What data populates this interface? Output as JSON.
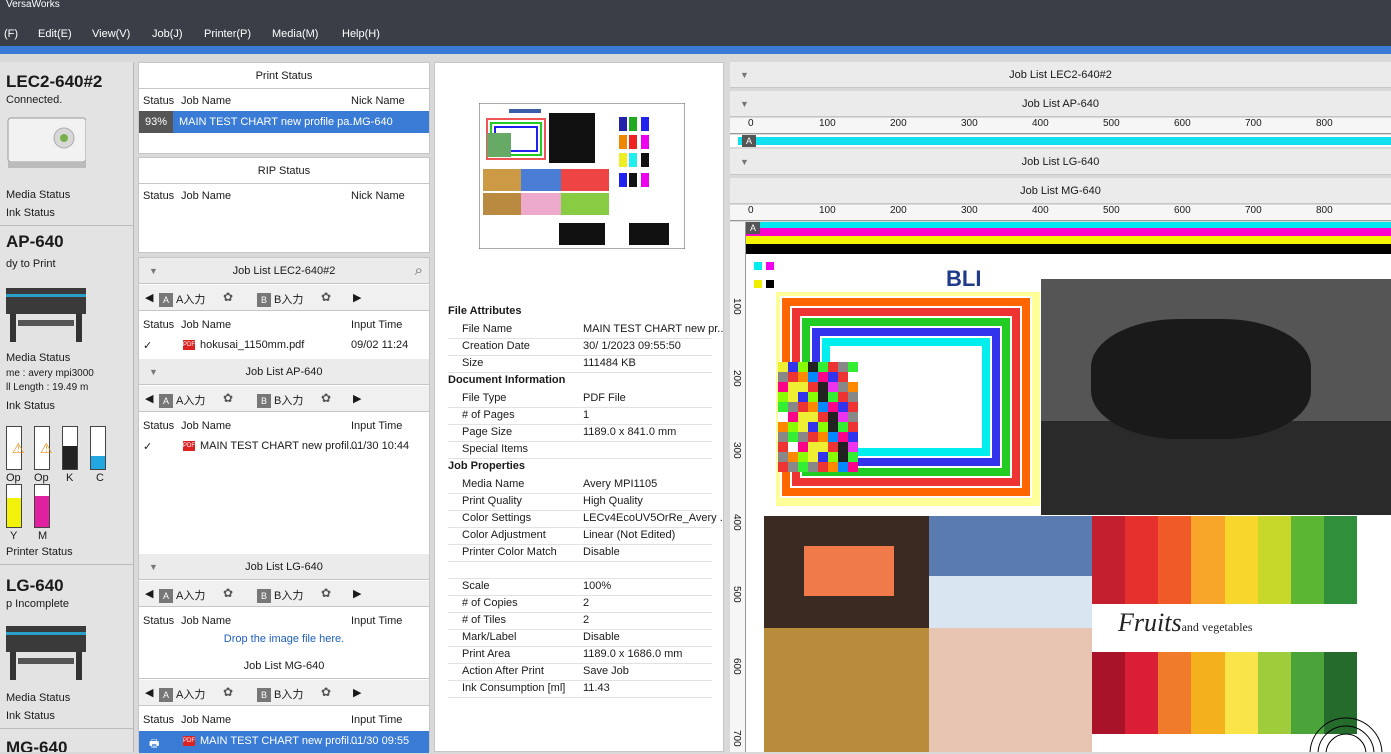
{
  "app": {
    "title": "VersaWorks"
  },
  "menu": [
    "(F)",
    "Edit(E)",
    "View(V)",
    "Job(J)",
    "Printer(P)",
    "Media(M)",
    "Help(H)"
  ],
  "printers": [
    {
      "name": "LEC2-640#2",
      "status": "Connected.",
      "media_status": "Media Status",
      "ink_status": "Ink Status"
    },
    {
      "name": "AP-640",
      "status": "dy to Print",
      "media_status": "Media Status",
      "media_name": "me : avery mpi3000",
      "roll_length": "ll Length : 19.49 m",
      "ink_status": "Ink Status",
      "printer_status": "Printer Status"
    },
    {
      "name": "LG-640",
      "status": "p Incomplete",
      "media_status": "Media Status",
      "ink_status": "Ink Status"
    },
    {
      "name": "MG-640"
    }
  ],
  "inks": [
    {
      "label": "Op",
      "color": "#ffffff",
      "warn": true,
      "level": 0.9
    },
    {
      "label": "Op",
      "color": "#ffffff",
      "warn": true,
      "level": 0.9
    },
    {
      "label": "K",
      "color": "#222222",
      "warn": false,
      "level": 0.55
    },
    {
      "label": "C",
      "color": "#22a7e0",
      "warn": false,
      "level": 0.3
    },
    {
      "label": "Y",
      "color": "#f2f20a",
      "warn": false,
      "level": 0.7
    },
    {
      "label": "M",
      "color": "#e020a0",
      "warn": false,
      "level": 0.75
    }
  ],
  "print_status": {
    "title": "Print Status",
    "columns": [
      "Status",
      "Job Name",
      "Nick Name"
    ],
    "row": {
      "status": "93%",
      "job": "MAIN TEST CHART new profile pa...",
      "nick": "MG-640"
    }
  },
  "rip_status": {
    "title": "RIP Status",
    "columns": [
      "Status",
      "Job Name",
      "Nick Name"
    ]
  },
  "queues": {
    "tab_a": "A入力",
    "tab_b": "B入力",
    "columns": [
      "Status",
      "Job Name",
      "Input Time"
    ],
    "lec": {
      "title": "Job List LEC2-640#2",
      "file": "hokusai_1150mm.pdf",
      "time": "09/02 11:24"
    },
    "ap": {
      "title": "Job List AP-640",
      "file": "MAIN TEST CHART new profil...",
      "time": "01/30 10:44"
    },
    "lg": {
      "title": "Job List LG-640",
      "drop": "Drop the image file here."
    },
    "mg": {
      "title": "Job List MG-640",
      "file": "MAIN TEST CHART new profil...",
      "time": "01/30 09:55"
    }
  },
  "file_attributes": {
    "sections": [
      {
        "title": "File Attributes",
        "rows": [
          [
            "File Name",
            "MAIN TEST CHART new pr..."
          ],
          [
            "Creation Date",
            "30/ 1/2023 09:55:50"
          ],
          [
            "Size",
            "111484 KB"
          ]
        ]
      },
      {
        "title": "Document Information",
        "rows": [
          [
            "File Type",
            "PDF File"
          ],
          [
            "# of Pages",
            "1"
          ],
          [
            "Page Size",
            "1189.0 x 841.0 mm"
          ],
          [
            "Special Items",
            ""
          ]
        ]
      },
      {
        "title": "Job Properties",
        "rows": [
          [
            "Media Name",
            "Avery MPI1105"
          ],
          [
            "Print Quality",
            "High Quality"
          ],
          [
            "Color Settings",
            "LECv4EcoUV5OrRe_Avery ..."
          ],
          [
            "Color Adjustment",
            "Linear (Not Edited)"
          ],
          [
            "Printer Color Match",
            "Disable"
          ],
          [
            "",
            ""
          ],
          [
            "Scale",
            "100%"
          ],
          [
            "# of Copies",
            "2"
          ],
          [
            "# of Tiles",
            "2"
          ],
          [
            "Mark/Label",
            "Disable"
          ],
          [
            "Print Area",
            "1189.0 x 1686.0 mm"
          ],
          [
            "Action After Print",
            "Save Job"
          ],
          [
            "Ink Consumption [ml]",
            "11.43"
          ]
        ]
      }
    ]
  },
  "job_lists_right": {
    "lec": "Job List LEC2-640#2",
    "ap": "Job List AP-640",
    "lg": "Job List LG-640",
    "mg": "Job List MG-640",
    "ruler_marks": [
      "0",
      "100",
      "200",
      "300",
      "400",
      "500",
      "600",
      "700",
      "800"
    ],
    "vruler_marks": [
      "100",
      "200",
      "300",
      "400",
      "500",
      "600",
      "700"
    ],
    "section_letter": "A",
    "preview_logo": "BLI",
    "fruits_word": "Fruits",
    "fruits_tail": "and vegetables"
  }
}
